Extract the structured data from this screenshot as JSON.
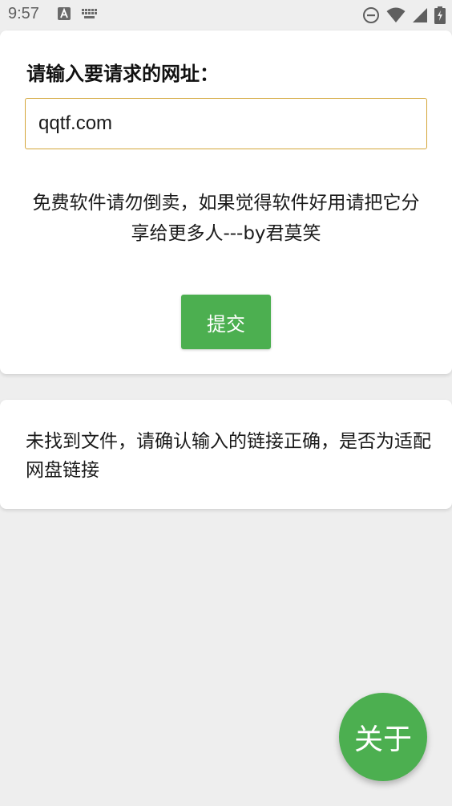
{
  "status_bar": {
    "time": "9:57",
    "icons": [
      "a-letter-icon",
      "keyboard-icon",
      "do-not-disturb-icon",
      "wifi-icon",
      "signal-icon",
      "battery-charging-icon"
    ]
  },
  "form": {
    "label": "请输入要请求的网址：",
    "url_value": "qqtf.com",
    "notice": "免费软件请勿倒卖，如果觉得软件好用请把它分享给更多人---by君莫笑",
    "submit_label": "提交"
  },
  "result": {
    "message": "未找到文件，请确认输入的链接正确，是否为适配网盘链接"
  },
  "fab": {
    "label": "关于"
  },
  "colors": {
    "accent_green": "#4caf50",
    "input_border": "#d4a63a",
    "background": "#eeeeee",
    "card": "#ffffff"
  }
}
